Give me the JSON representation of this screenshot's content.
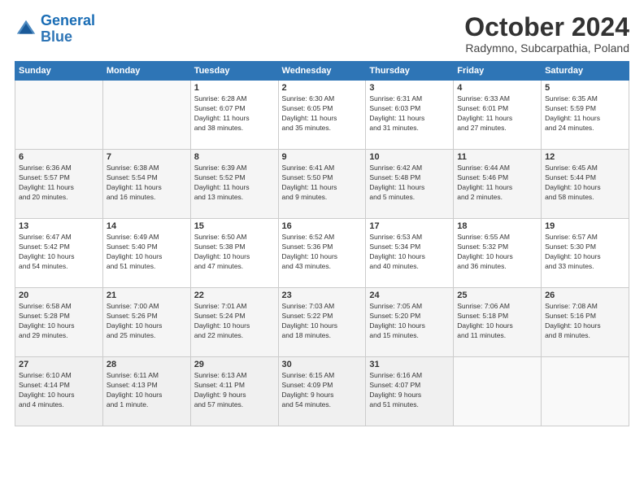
{
  "header": {
    "logo_general": "General",
    "logo_blue": "Blue",
    "month": "October 2024",
    "location": "Radymno, Subcarpathia, Poland"
  },
  "days_of_week": [
    "Sunday",
    "Monday",
    "Tuesday",
    "Wednesday",
    "Thursday",
    "Friday",
    "Saturday"
  ],
  "weeks": [
    [
      {
        "day": "",
        "info": ""
      },
      {
        "day": "",
        "info": ""
      },
      {
        "day": "1",
        "info": "Sunrise: 6:28 AM\nSunset: 6:07 PM\nDaylight: 11 hours\nand 38 minutes."
      },
      {
        "day": "2",
        "info": "Sunrise: 6:30 AM\nSunset: 6:05 PM\nDaylight: 11 hours\nand 35 minutes."
      },
      {
        "day": "3",
        "info": "Sunrise: 6:31 AM\nSunset: 6:03 PM\nDaylight: 11 hours\nand 31 minutes."
      },
      {
        "day": "4",
        "info": "Sunrise: 6:33 AM\nSunset: 6:01 PM\nDaylight: 11 hours\nand 27 minutes."
      },
      {
        "day": "5",
        "info": "Sunrise: 6:35 AM\nSunset: 5:59 PM\nDaylight: 11 hours\nand 24 minutes."
      }
    ],
    [
      {
        "day": "6",
        "info": "Sunrise: 6:36 AM\nSunset: 5:57 PM\nDaylight: 11 hours\nand 20 minutes."
      },
      {
        "day": "7",
        "info": "Sunrise: 6:38 AM\nSunset: 5:54 PM\nDaylight: 11 hours\nand 16 minutes."
      },
      {
        "day": "8",
        "info": "Sunrise: 6:39 AM\nSunset: 5:52 PM\nDaylight: 11 hours\nand 13 minutes."
      },
      {
        "day": "9",
        "info": "Sunrise: 6:41 AM\nSunset: 5:50 PM\nDaylight: 11 hours\nand 9 minutes."
      },
      {
        "day": "10",
        "info": "Sunrise: 6:42 AM\nSunset: 5:48 PM\nDaylight: 11 hours\nand 5 minutes."
      },
      {
        "day": "11",
        "info": "Sunrise: 6:44 AM\nSunset: 5:46 PM\nDaylight: 11 hours\nand 2 minutes."
      },
      {
        "day": "12",
        "info": "Sunrise: 6:45 AM\nSunset: 5:44 PM\nDaylight: 10 hours\nand 58 minutes."
      }
    ],
    [
      {
        "day": "13",
        "info": "Sunrise: 6:47 AM\nSunset: 5:42 PM\nDaylight: 10 hours\nand 54 minutes."
      },
      {
        "day": "14",
        "info": "Sunrise: 6:49 AM\nSunset: 5:40 PM\nDaylight: 10 hours\nand 51 minutes."
      },
      {
        "day": "15",
        "info": "Sunrise: 6:50 AM\nSunset: 5:38 PM\nDaylight: 10 hours\nand 47 minutes."
      },
      {
        "day": "16",
        "info": "Sunrise: 6:52 AM\nSunset: 5:36 PM\nDaylight: 10 hours\nand 43 minutes."
      },
      {
        "day": "17",
        "info": "Sunrise: 6:53 AM\nSunset: 5:34 PM\nDaylight: 10 hours\nand 40 minutes."
      },
      {
        "day": "18",
        "info": "Sunrise: 6:55 AM\nSunset: 5:32 PM\nDaylight: 10 hours\nand 36 minutes."
      },
      {
        "day": "19",
        "info": "Sunrise: 6:57 AM\nSunset: 5:30 PM\nDaylight: 10 hours\nand 33 minutes."
      }
    ],
    [
      {
        "day": "20",
        "info": "Sunrise: 6:58 AM\nSunset: 5:28 PM\nDaylight: 10 hours\nand 29 minutes."
      },
      {
        "day": "21",
        "info": "Sunrise: 7:00 AM\nSunset: 5:26 PM\nDaylight: 10 hours\nand 25 minutes."
      },
      {
        "day": "22",
        "info": "Sunrise: 7:01 AM\nSunset: 5:24 PM\nDaylight: 10 hours\nand 22 minutes."
      },
      {
        "day": "23",
        "info": "Sunrise: 7:03 AM\nSunset: 5:22 PM\nDaylight: 10 hours\nand 18 minutes."
      },
      {
        "day": "24",
        "info": "Sunrise: 7:05 AM\nSunset: 5:20 PM\nDaylight: 10 hours\nand 15 minutes."
      },
      {
        "day": "25",
        "info": "Sunrise: 7:06 AM\nSunset: 5:18 PM\nDaylight: 10 hours\nand 11 minutes."
      },
      {
        "day": "26",
        "info": "Sunrise: 7:08 AM\nSunset: 5:16 PM\nDaylight: 10 hours\nand 8 minutes."
      }
    ],
    [
      {
        "day": "27",
        "info": "Sunrise: 6:10 AM\nSunset: 4:14 PM\nDaylight: 10 hours\nand 4 minutes."
      },
      {
        "day": "28",
        "info": "Sunrise: 6:11 AM\nSunset: 4:13 PM\nDaylight: 10 hours\nand 1 minute."
      },
      {
        "day": "29",
        "info": "Sunrise: 6:13 AM\nSunset: 4:11 PM\nDaylight: 9 hours\nand 57 minutes."
      },
      {
        "day": "30",
        "info": "Sunrise: 6:15 AM\nSunset: 4:09 PM\nDaylight: 9 hours\nand 54 minutes."
      },
      {
        "day": "31",
        "info": "Sunrise: 6:16 AM\nSunset: 4:07 PM\nDaylight: 9 hours\nand 51 minutes."
      },
      {
        "day": "",
        "info": ""
      },
      {
        "day": "",
        "info": ""
      }
    ]
  ]
}
